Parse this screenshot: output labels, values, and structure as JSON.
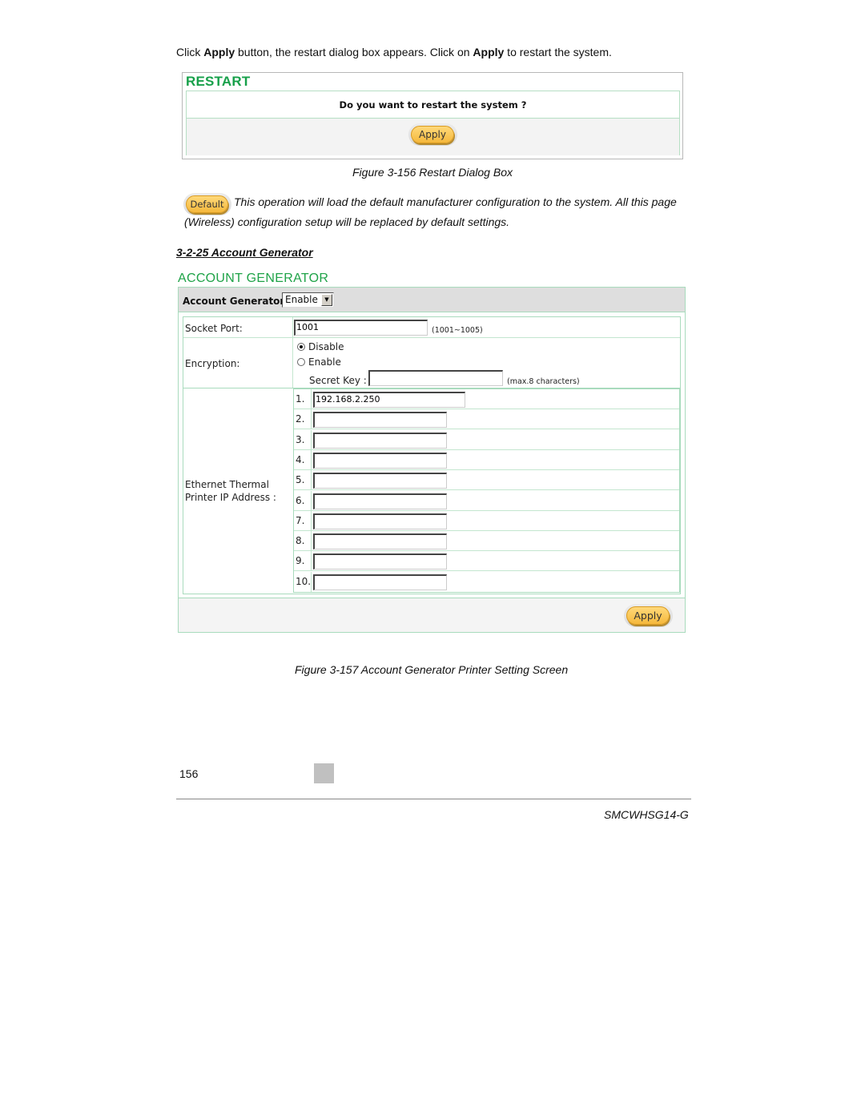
{
  "intro": {
    "parts": [
      "Click ",
      "Apply",
      " button, the restart dialog box appears. Click on ",
      "Apply",
      " to restart the system."
    ]
  },
  "restart_dialog": {
    "title": "RESTART",
    "question": "Do you want to restart the system ?",
    "apply_label": "Apply"
  },
  "figure_156_caption": "Figure 3-156 Restart Dialog Box",
  "default_note": {
    "button_label": "Default",
    "text": "This operation will load the default manufacturer configuration to the system. All this page (Wireless) configuration setup will be replaced by default settings."
  },
  "section_heading": "3-2-25 Account Generator",
  "account_generator": {
    "title": "ACCOUNT GENERATOR",
    "header_label": "Account Generator:",
    "mode_select": {
      "value": "Enable"
    },
    "socket_port": {
      "label": "Socket Port:",
      "value": "1001",
      "hint": "(1001~1005)"
    },
    "encryption": {
      "label": "Encryption:",
      "options": [
        {
          "label": "Disable",
          "selected": true
        },
        {
          "label": "Enable",
          "selected": false
        }
      ],
      "secret_key_label": "Secret Key :",
      "secret_key_value": "",
      "secret_key_hint": "(max.8 characters)"
    },
    "printer_ip": {
      "label_line1": "Ethernet Thermal",
      "label_line2": "Printer IP Address :",
      "entries": [
        {
          "num": "1.",
          "value": "192.168.2.250"
        },
        {
          "num": "2.",
          "value": ""
        },
        {
          "num": "3.",
          "value": ""
        },
        {
          "num": "4.",
          "value": ""
        },
        {
          "num": "5.",
          "value": ""
        },
        {
          "num": "6.",
          "value": ""
        },
        {
          "num": "7.",
          "value": ""
        },
        {
          "num": "8.",
          "value": ""
        },
        {
          "num": "9.",
          "value": ""
        },
        {
          "num": "10.",
          "value": ""
        }
      ]
    },
    "apply_label": "Apply"
  },
  "figure_157_caption": "Figure 3-157 Account Generator Printer Setting Screen",
  "footer": {
    "page_number": "156",
    "model": "SMCWHSG14-G"
  },
  "colors": {
    "heading_green": "#17a04a",
    "border_green": "#a9dbbd",
    "button_yellow": "#f5b83c"
  }
}
